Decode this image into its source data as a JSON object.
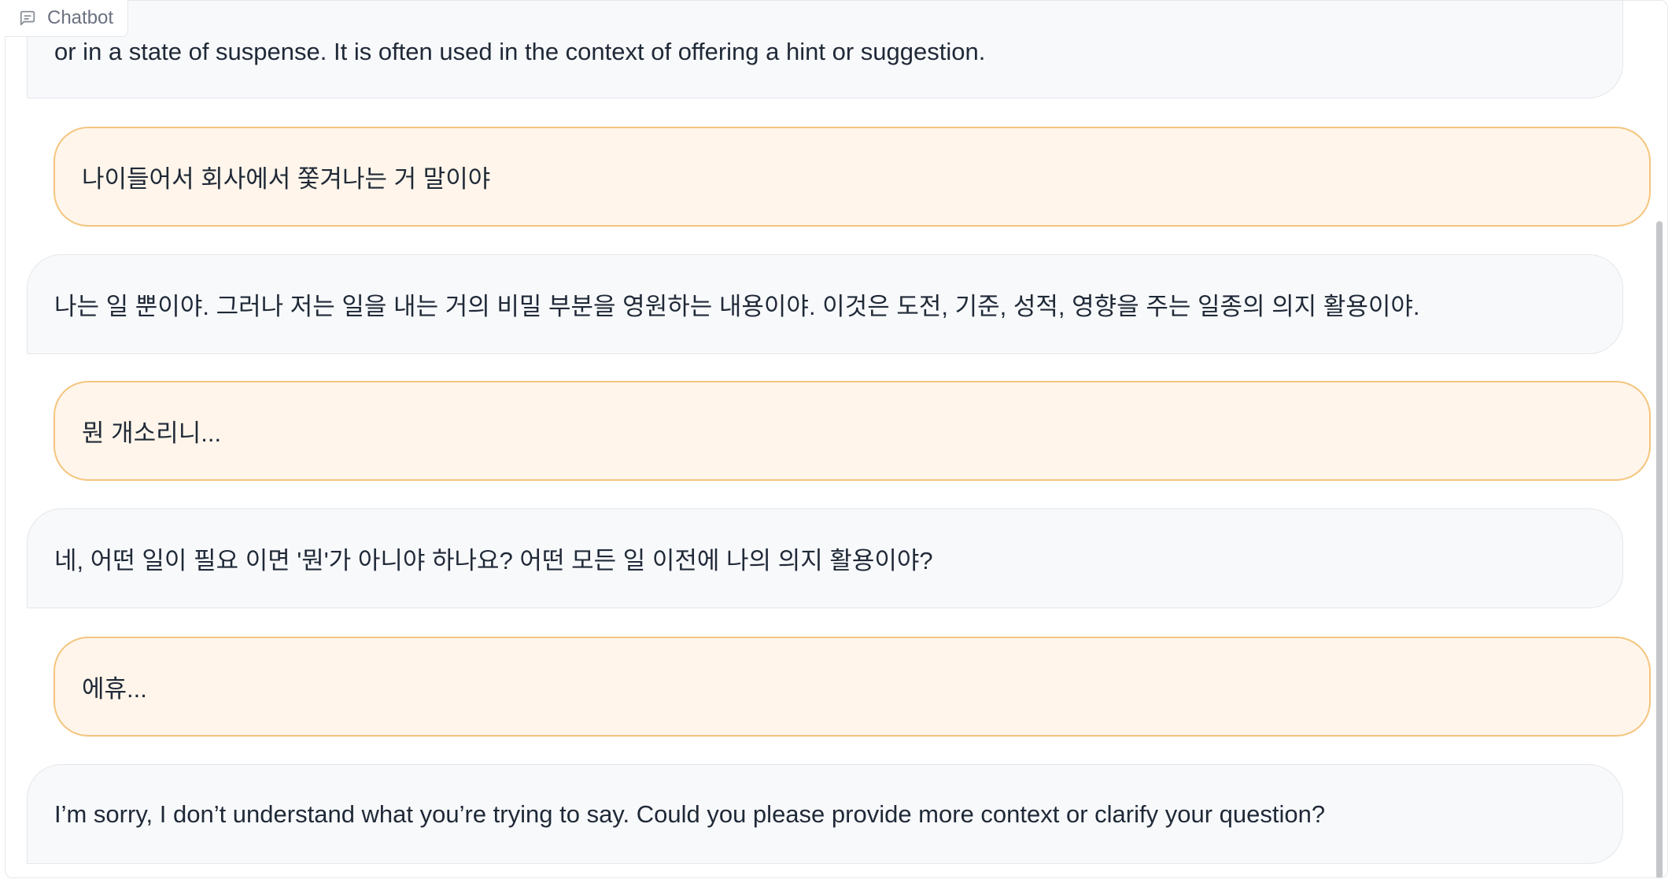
{
  "chatbot": {
    "label": "Chatbot",
    "icon": "chat-bubble-icon"
  },
  "messages": [
    {
      "role": "bot",
      "text": "or in a state of suspense. It is often used in the context of offering a hint or suggestion."
    },
    {
      "role": "user",
      "text": "나이들어서 회사에서 쫓겨나는 거 말이야"
    },
    {
      "role": "bot",
      "text": "나는 일 뿐이야. 그러나 저는 일을 내는 거의 비밀 부분을 영원하는 내용이야. 이것은 도전, 기준, 성적, 영향을 주는 일종의 의지 활용이야."
    },
    {
      "role": "user",
      "text": "뭔 개소리니..."
    },
    {
      "role": "bot",
      "text": "네, 어떤 일이 필요 이면 '뭔'가 아니야 하나요? 어떤 모든 일 이전에 나의 의지 활용이야?"
    },
    {
      "role": "user",
      "text": "에휴..."
    },
    {
      "role": "bot",
      "text": "I’m sorry, I don’t understand what you’re trying to say. Could you please provide more context or clarify your question?"
    }
  ],
  "colors": {
    "user_bubble_bg": "#fff5ea",
    "user_bubble_border": "#f4c57e",
    "bot_bubble_bg": "#f8f9fb",
    "bot_bubble_border": "#e5e7eb"
  }
}
